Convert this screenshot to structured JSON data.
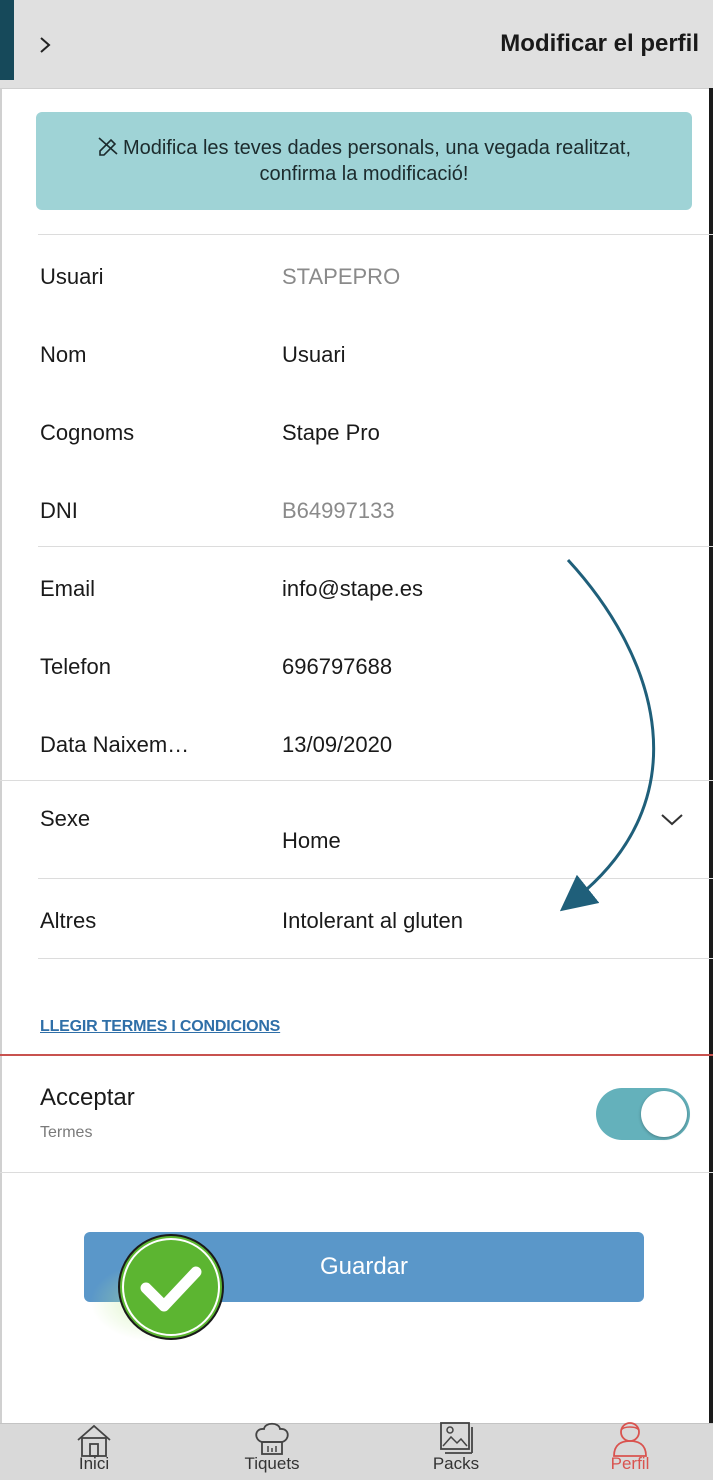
{
  "header": {
    "title": "Modificar el perfil",
    "back_glyph": "›"
  },
  "banner": {
    "icon": "edit-off-icon",
    "text": "Modifica les teves dades personals, una vegada realitzat, confirma la modificació!"
  },
  "fields": [
    {
      "label": "Usuari",
      "value": "STAPEPRO",
      "editable": false
    },
    {
      "label": "Nom",
      "value": "Usuari",
      "editable": true
    },
    {
      "label": "Cognoms",
      "value": "Stape Pro",
      "editable": true
    },
    {
      "label": "DNI",
      "value": "B64997133",
      "editable": false
    },
    {
      "label": "Email",
      "value": "info@stape.es",
      "editable": true
    },
    {
      "label": "Telefon",
      "value": "696797688",
      "editable": true
    },
    {
      "label": "Data Naixem…",
      "value": "13/09/2020",
      "editable": true
    },
    {
      "label": "Sexe",
      "value": "Home",
      "editable": true
    },
    {
      "label": "Altres",
      "value": "Intolerant al gluten",
      "editable": true
    }
  ],
  "terms": {
    "link_text": "LLEGIR TERMES I CONDICIONS",
    "accept_label": "Acceptar",
    "accept_sub": "Termes",
    "accepted": true
  },
  "save_button": {
    "label": "Guardar"
  },
  "tabs": [
    {
      "label": "Inici",
      "icon": "home-icon",
      "active": false
    },
    {
      "label": "Tiquets",
      "icon": "chef-hat-icon",
      "active": false
    },
    {
      "label": "Packs",
      "icon": "gallery-icon",
      "active": false
    },
    {
      "label": "Perfil",
      "icon": "user-icon",
      "active": true
    }
  ],
  "colors": {
    "banner_bg": "#9fd3d6",
    "toggle_on": "#64b1bb",
    "button_bg": "#5a97c9",
    "active_tab": "#d9534f",
    "link": "#2f6fa8",
    "annotation_arrow": "#1f5f7a",
    "check_green": "#5cb531"
  }
}
